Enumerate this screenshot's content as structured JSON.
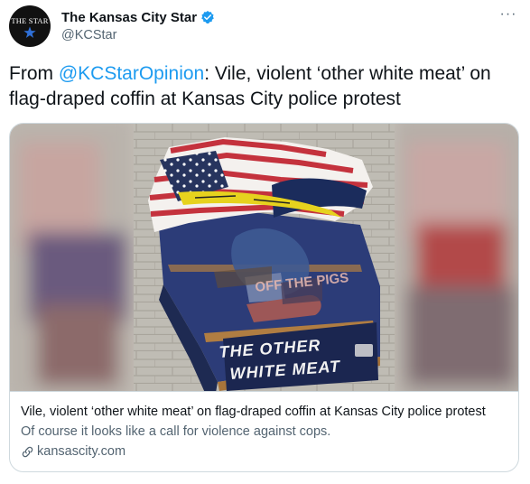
{
  "header": {
    "avatar_text": "THE STAR",
    "display_name": "The Kansas City Star",
    "handle": "@KCStar",
    "more_label": "···"
  },
  "tweet": {
    "prefix": "From ",
    "mention": "@KCStarOpinion",
    "body": ": Vile, violent ‘other white meat’ on flag-draped coffin at Kansas City police protest"
  },
  "card": {
    "image_text_top": "OFF THE PIGS",
    "image_text_line1": "THE OTHER",
    "image_text_line2": "WHITE MEAT",
    "title": "Vile, violent ‘other white meat’ on flag-draped coffin at Kansas City police protest",
    "description": "Of course it looks like a call for violence against cops.",
    "domain": "kansascity.com"
  },
  "colors": {
    "accent": "#1d9bf0",
    "text": "#0f1419",
    "secondary": "#536471",
    "border": "#cfd9de"
  },
  "icons": [
    "star-icon",
    "verified-badge-icon",
    "more-icon",
    "link-icon"
  ]
}
